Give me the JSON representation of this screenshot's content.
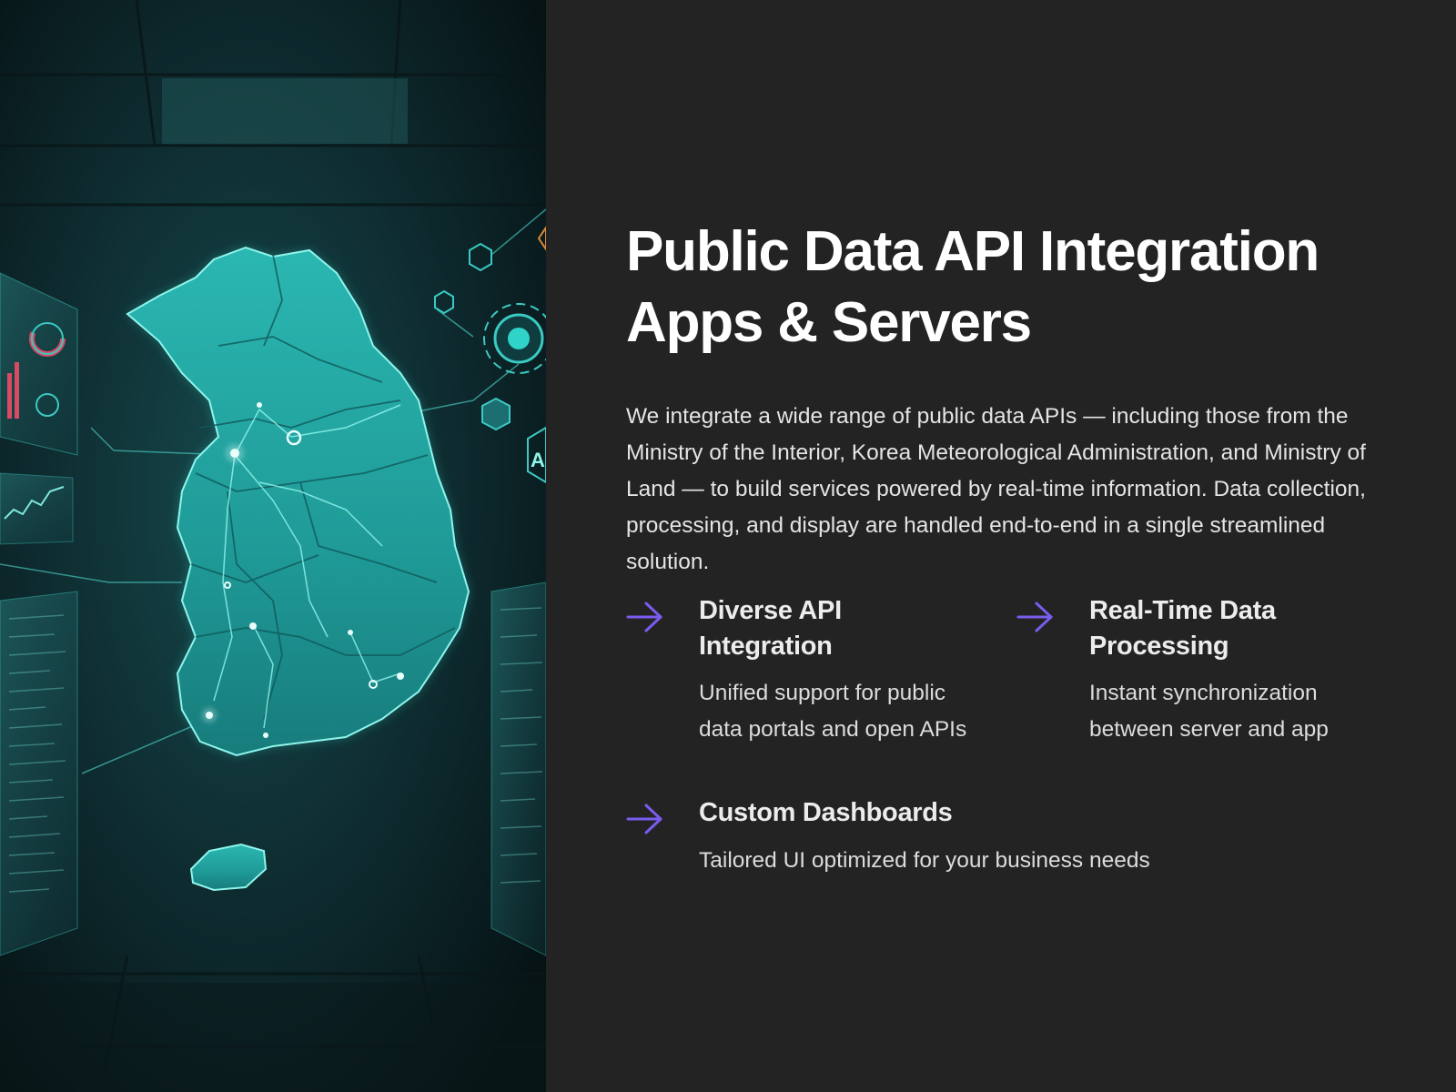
{
  "hero": {
    "image": "digital-map-of-korea-illustration",
    "overlay_text": "AI"
  },
  "heading": {
    "line1": "Public Data API Integration",
    "line2": "Apps & Servers"
  },
  "intro": "We integrate a wide range of public data APIs — including those from the Ministry of the Interior, Korea Meteorological Administration, and Ministry of Land — to build services powered by real-time information. Data collection, processing, and display are handled end-to-end in a single streamlined solution.",
  "features": [
    {
      "icon": "arrow-right-icon",
      "title": "Diverse API Integration",
      "description": "Unified support for public data portals and open APIs"
    },
    {
      "icon": "arrow-right-icon",
      "title": "Real-Time Data Processing",
      "description": "Instant synchronization between server and app"
    },
    {
      "icon": "arrow-right-icon",
      "title": "Custom Dashboards",
      "description": "Tailored UI optimized for your business needs"
    }
  ],
  "colors": {
    "background": "#242324",
    "accent_arrow": "#7b5cf0",
    "map_glow": "#2fd3c8",
    "hero_dark": "#0b1c1f"
  }
}
